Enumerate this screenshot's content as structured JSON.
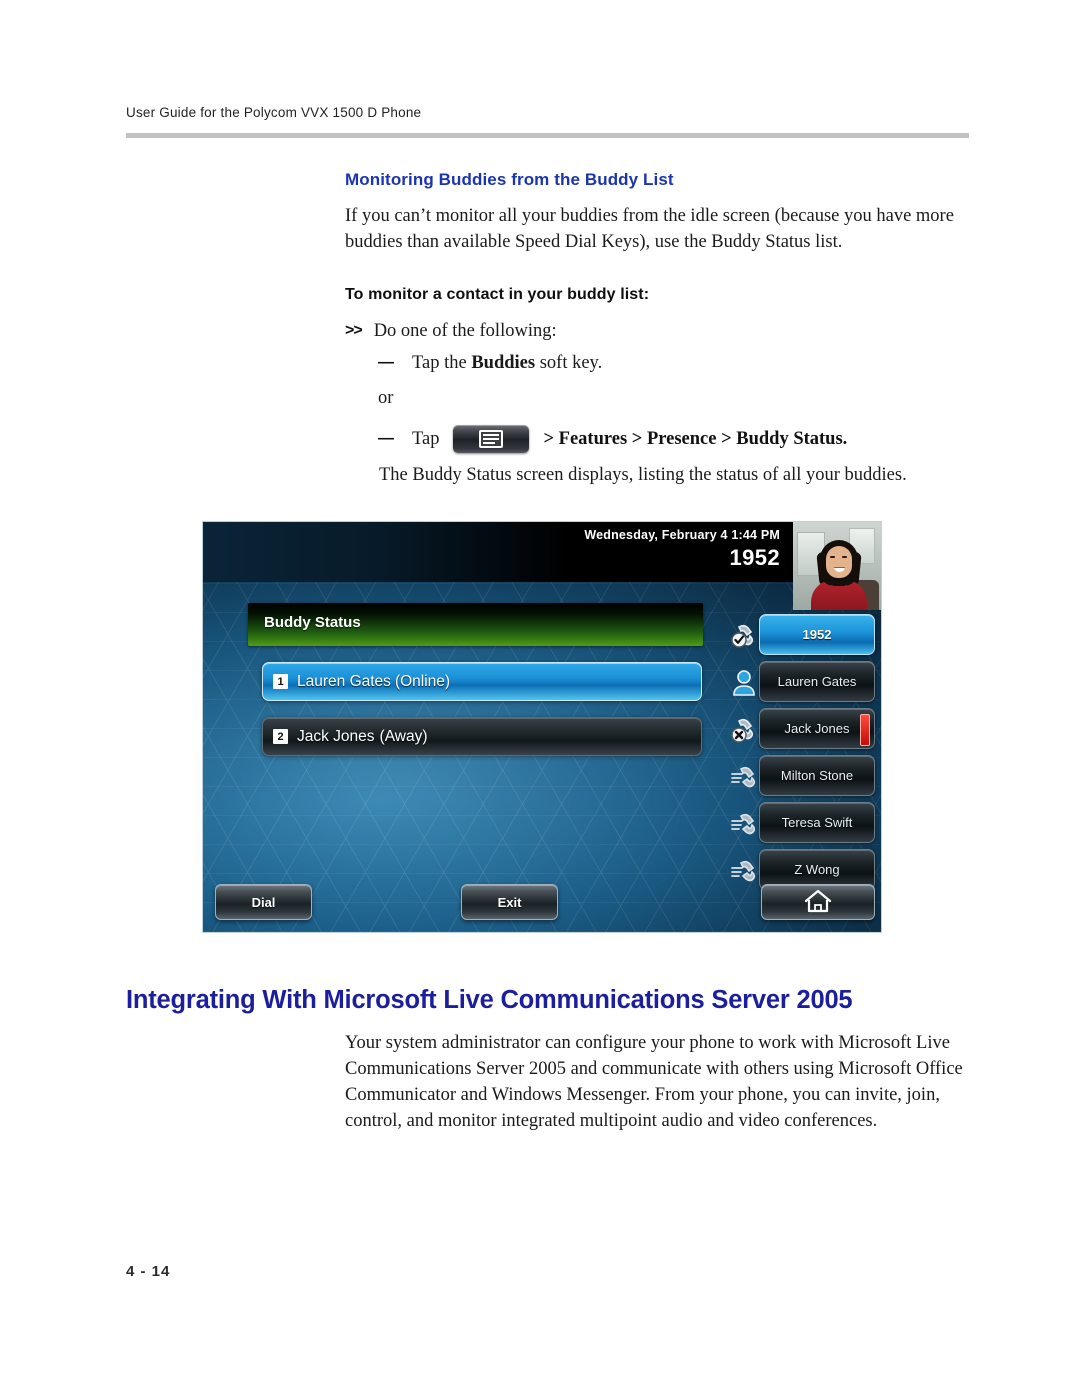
{
  "document": {
    "running_header": "User Guide for the Polycom VVX 1500 D Phone",
    "page_number": "4 - 14",
    "heading_color": "#1b35b0",
    "chapter_heading_color": "#1b1f9e"
  },
  "section": {
    "heading": "Monitoring Buddies from the Buddy List",
    "intro_paragraph": "If you can’t monitor all your buddies from the idle screen (because you have more buddies than available Speed Dial Keys), use the Buddy Status list.",
    "procedure_title": "To monitor a contact in your buddy list:",
    "step_marker": ">>",
    "step_text": "Do one of the following:",
    "sub_dash": "—",
    "sub_step_1_prefix": "Tap the ",
    "sub_step_1_bold": "Buddies",
    "sub_step_1_suffix": " soft key.",
    "or_text": "or",
    "sub_step_2_prefix": "Tap",
    "menu_key_icon": "menu-key-icon",
    "breadcrumb": "> Features > Presence > Buddy Status.",
    "result_text": "The Buddy Status screen displays, listing the status of all your buddies."
  },
  "chapter": {
    "heading": "Integrating With Microsoft Live Communications Server 2005",
    "paragraph": "Your system administrator can configure your phone to work with Microsoft Live Communications Server 2005 and communicate with others using Microsoft Office Communicator and Windows Messenger. From your phone, you can invite, join, control, and monitor integrated multipoint audio and video conferences."
  },
  "phone_screen": {
    "status_bar": {
      "date_time": "Wednesday, February 4  1:44 PM",
      "extension": "1952"
    },
    "video_thumbnail": "video-thumbnail",
    "title_bar": {
      "title": "Buddy Status",
      "accent_color": "#4f9b16"
    },
    "buddy_list": [
      {
        "index": "1",
        "name": "Lauren Gates",
        "status": "(Online)",
        "selected": true
      },
      {
        "index": "2",
        "name": "Jack Jones",
        "status": "(Away)",
        "selected": false
      }
    ],
    "line_keys": [
      {
        "label": "1952",
        "icon": "handset-registered-icon",
        "active": true,
        "red_indicator": false
      },
      {
        "label": "Lauren Gates",
        "icon": "buddy-online-icon",
        "active": false,
        "red_indicator": false
      },
      {
        "label": "Jack Jones",
        "icon": "handset-unavailable-icon",
        "active": false,
        "red_indicator": true
      },
      {
        "label": "Milton Stone",
        "icon": "handset-icon",
        "active": false,
        "red_indicator": false
      },
      {
        "label": "Teresa Swift",
        "icon": "handset-icon",
        "active": false,
        "red_indicator": false
      },
      {
        "label": "Z Wong",
        "icon": "handset-icon",
        "active": false,
        "red_indicator": false
      }
    ],
    "soft_keys": [
      {
        "label": "Dial",
        "name": "dial-soft-key"
      },
      {
        "label": "Exit",
        "name": "exit-soft-key"
      },
      {
        "label": "",
        "name": "home-soft-key",
        "icon": "home-icon"
      }
    ]
  }
}
